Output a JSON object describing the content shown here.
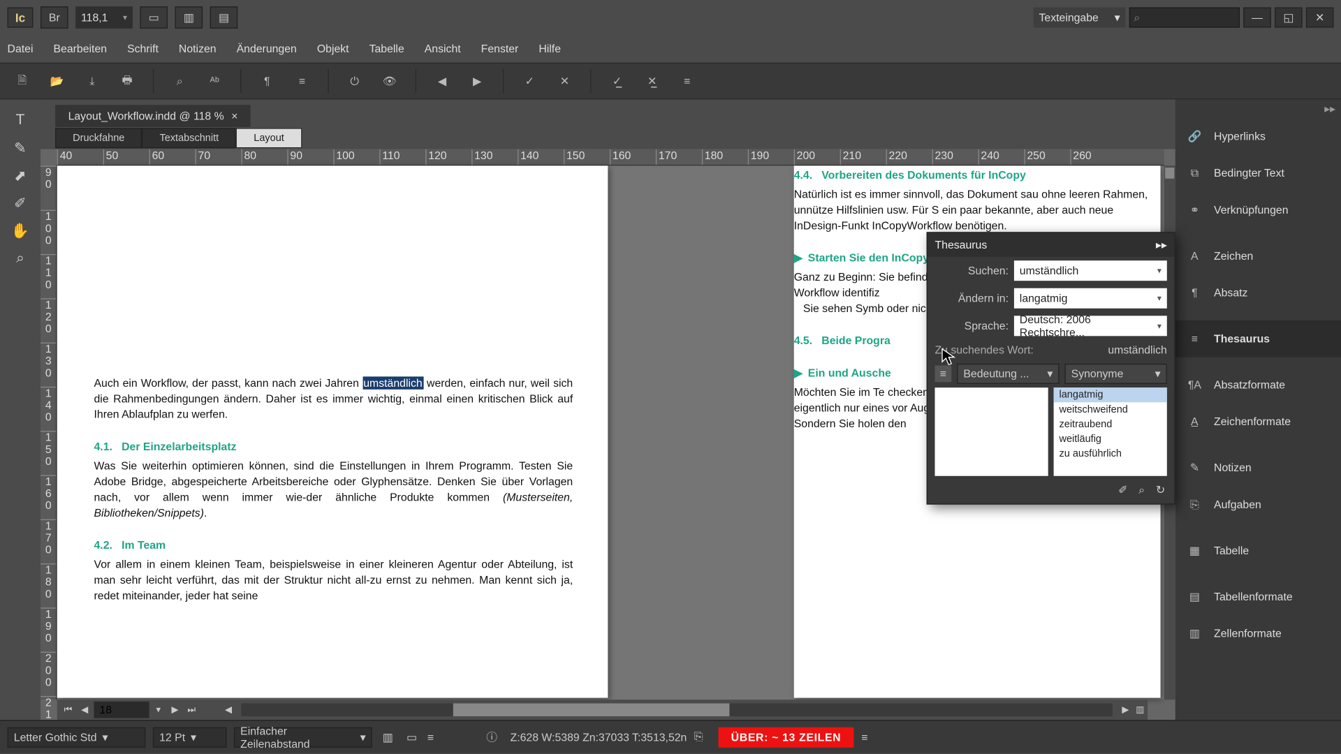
{
  "app": {
    "name": "Ic",
    "bridge": "Br"
  },
  "zoom": "118,1",
  "mode": "Texteingabe",
  "menu": [
    "Datei",
    "Bearbeiten",
    "Schrift",
    "Notizen",
    "Änderungen",
    "Objekt",
    "Tabelle",
    "Ansicht",
    "Fenster",
    "Hilfe"
  ],
  "doc_tab": "Layout_Workflow.indd @ 118 %",
  "view_tabs": [
    "Druckfahne",
    "Textabschnitt",
    "Layout"
  ],
  "ruler_h": [
    "40",
    "50",
    "60",
    "70",
    "80",
    "90",
    "100",
    "110",
    "120",
    "130",
    "140",
    "150",
    "160",
    "170",
    "180",
    "190",
    "200",
    "210",
    "220",
    "230",
    "240",
    "250",
    "260"
  ],
  "ruler_v": [
    "9\n0",
    "1\n0\n0",
    "1\n1\n0",
    "1\n2\n0",
    "1\n3\n0",
    "1\n4\n0",
    "1\n5\n0",
    "1\n6\n0",
    "1\n7\n0",
    "1\n8\n0",
    "1\n9\n0",
    "2\n0\n0",
    "2\n1\n0"
  ],
  "page_nav": "18",
  "left_page": {
    "para1_a": "Auch ein Workflow, der passt, kann nach zwei Jahren ",
    "sel": "umständlich",
    "para1_b": " werden, einfach nur, weil sich die Rahmenbedingungen ändern. Daher ist es immer wichtig, einmal einen kritischen Blick auf Ihren Ablaufplan zu werfen.",
    "h41_num": "4.1.",
    "h41": "Der Einzelarbeitsplatz",
    "p41": "Was Sie weiterhin optimieren können, sind die Einstellungen in Ihrem Programm. Testen Sie Adobe Bridge, abgespeicherte Arbeitsbereiche oder Glyphensätze. Denken Sie über Vorlagen nach, vor allem wenn immer wie-der ähnliche Produkte kommen ",
    "p41_it": "(Musterseiten, Bibliotheken/Snippets)",
    "h42_num": "4.2.",
    "h42": "Im Team",
    "p42": "Vor allem in einem kleinen Team, beispielsweise in einer kleineren Agentur oder Abteilung, ist man sehr leicht verführt, das mit der Struktur nicht all-zu ernst zu nehmen. Man kennt sich ja, redet miteinander, jeder hat seine"
  },
  "right_page": {
    "h44_num": "4.4.",
    "h44": "Vorbereiten des Dokuments für InCopy",
    "p44": "Natürlich ist es immer sinnvoll, das Dokument sau ohne leeren Rahmen, unnütze Hilfslinien usw. Für S ein paar bekannte, aber auch neue InDesign-Funkt InCopyWorkflow benötigen.",
    "sub1": "Starten Sie den InCopyWorkflow",
    "p_sub1": "Ganz zu Beginn: Sie befinden sich gleich in einem W rere Kollegen Zug Workflow identifiz",
    "p_sub1b": "   Sie sehen Symb oder nicht. Hat ei ben. Auch Bildra dann mit dem Pos in den vorhandene",
    "h45_num": "4.5.",
    "h45": "Beide Progra",
    "sub2": "Ein und Ausche",
    "p_sub2": "Möchten Sie im Te checken Sie ihn wi le Starter andersh Sie sich eigentlich nur eines vor Augen halten: Um e ten, checken nicht Sie ein. Sondern Sie holen den"
  },
  "thes": {
    "title": "Thesaurus",
    "l_search": "Suchen:",
    "v_search": "umständlich",
    "l_change": "Ändern in:",
    "v_change": "langatmig",
    "l_lang": "Sprache:",
    "v_lang": "Deutsch: 2006 Rechtschre...",
    "wordlbl": "Zu suchendes Wort:",
    "word": "umständlich",
    "dd1": "Bedeutung ...",
    "dd2": "Synonyme",
    "results": [
      "langatmig",
      "weitschweifend",
      "zeitraubend",
      "weitläufig",
      "zu ausführlich"
    ]
  },
  "panels": [
    "Hyperlinks",
    "Bedingter Text",
    "Verknüpfungen",
    "Zeichen",
    "Absatz",
    "Thesaurus",
    "Absatzformate",
    "Zeichenformate",
    "Notizen",
    "Aufgaben",
    "Tabelle",
    "Tabellenformate",
    "Zellenformate"
  ],
  "panel_icons": [
    "🔗",
    "⧉",
    "⚭",
    "A",
    "¶",
    "≡",
    "¶A",
    "A̲",
    "✎",
    "⎘",
    "▦",
    "▤",
    "▥"
  ],
  "status": {
    "font": "Letter Gothic Std",
    "size": "12 Pt",
    "leading": "Einfacher Zeilenabstand",
    "metrics": "Z:628    W:5389    Zn:37033   T:3513,52n",
    "over": "ÜBER:  ~ 13 ZEILEN"
  }
}
